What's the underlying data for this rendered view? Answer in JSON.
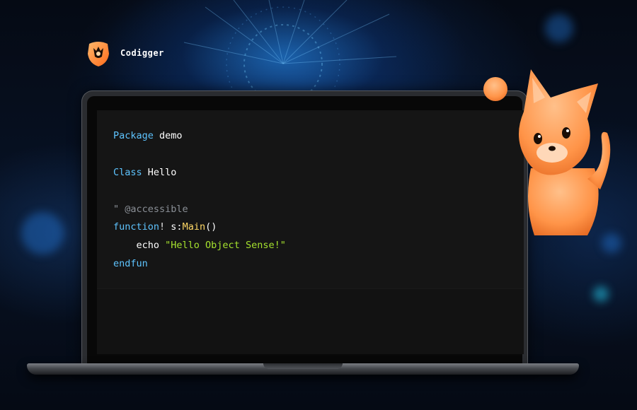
{
  "brand": {
    "name": "Codigger",
    "logo_icon": "codigger-logo-icon",
    "accent_color": "#ff8a2a"
  },
  "editor": {
    "colors": {
      "keyword": "#5ec4ff",
      "comment": "#8a8f96",
      "function": "#ffd866",
      "string": "#a6e22e",
      "background": "#151515"
    },
    "lines": [
      {
        "tokens": [
          {
            "t": "Package",
            "c": "kw"
          },
          {
            "t": " demo",
            "c": "plain"
          }
        ]
      },
      {
        "tokens": []
      },
      {
        "tokens": [
          {
            "t": "Class",
            "c": "kw"
          },
          {
            "t": " Hello",
            "c": "plain"
          }
        ]
      },
      {
        "tokens": []
      },
      {
        "tokens": [
          {
            "t": "\" @accessible",
            "c": "comment"
          }
        ]
      },
      {
        "tokens": [
          {
            "t": "function",
            "c": "kw"
          },
          {
            "t": "!",
            "c": "bang"
          },
          {
            "t": " s:",
            "c": "plain"
          },
          {
            "t": "Main",
            "c": "fn"
          },
          {
            "t": "()",
            "c": "plain"
          }
        ]
      },
      {
        "tokens": [
          {
            "t": "    echo ",
            "c": "plain"
          },
          {
            "t": "\"Hello Object Sense!\"",
            "c": "str"
          }
        ]
      },
      {
        "tokens": [
          {
            "t": "endfun",
            "c": "kw"
          }
        ]
      }
    ]
  },
  "mascot": {
    "icon": "fox-mascot-icon",
    "color": "#ff9a4a"
  }
}
